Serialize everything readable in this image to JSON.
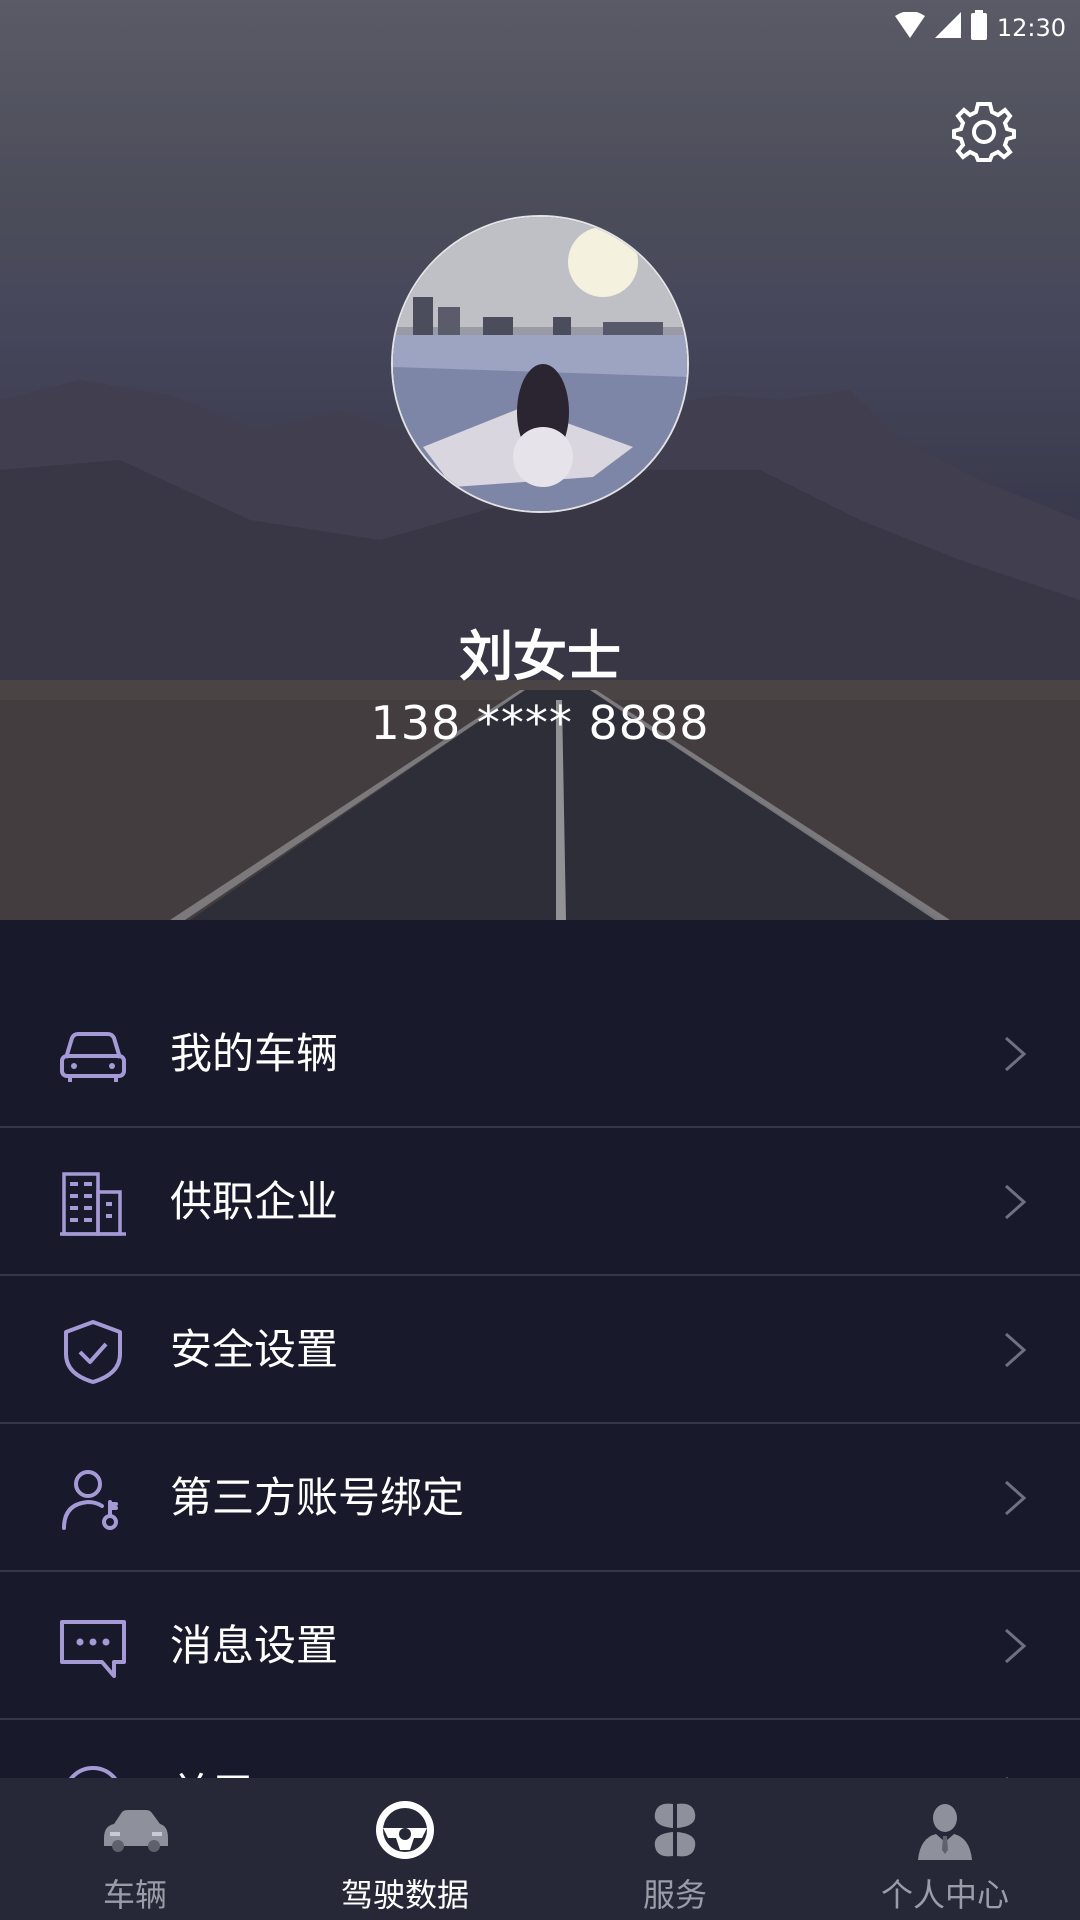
{
  "status_bar": {
    "time": "12:30",
    "icons": [
      "wifi-icon",
      "signal-icon",
      "battery-icon"
    ]
  },
  "header": {
    "settings_icon": "gear-icon"
  },
  "profile": {
    "name": "刘女士",
    "phone": "138 **** 8888"
  },
  "menu": {
    "items": [
      {
        "label": "我的车辆",
        "icon": "car-icon"
      },
      {
        "label": "供职企业",
        "icon": "building-icon"
      },
      {
        "label": "安全设置",
        "icon": "shield-check-icon"
      },
      {
        "label": "第三方账号绑定",
        "icon": "user-key-icon"
      },
      {
        "label": "消息设置",
        "icon": "message-icon"
      },
      {
        "label": "关于",
        "icon": "info-icon"
      }
    ]
  },
  "tabbar": {
    "tabs": [
      {
        "label": "车辆",
        "icon": "car-icon",
        "active": false
      },
      {
        "label": "驾驶数据",
        "icon": "steering-wheel-icon",
        "active": true
      },
      {
        "label": "服务",
        "icon": "clover-icon",
        "active": false
      },
      {
        "label": "个人中心",
        "icon": "person-icon",
        "active": false
      }
    ]
  },
  "colors": {
    "background": "#181a2b",
    "accent_icon": "#a59ad6",
    "divider": "#34364a",
    "tabbar": "#262838"
  }
}
